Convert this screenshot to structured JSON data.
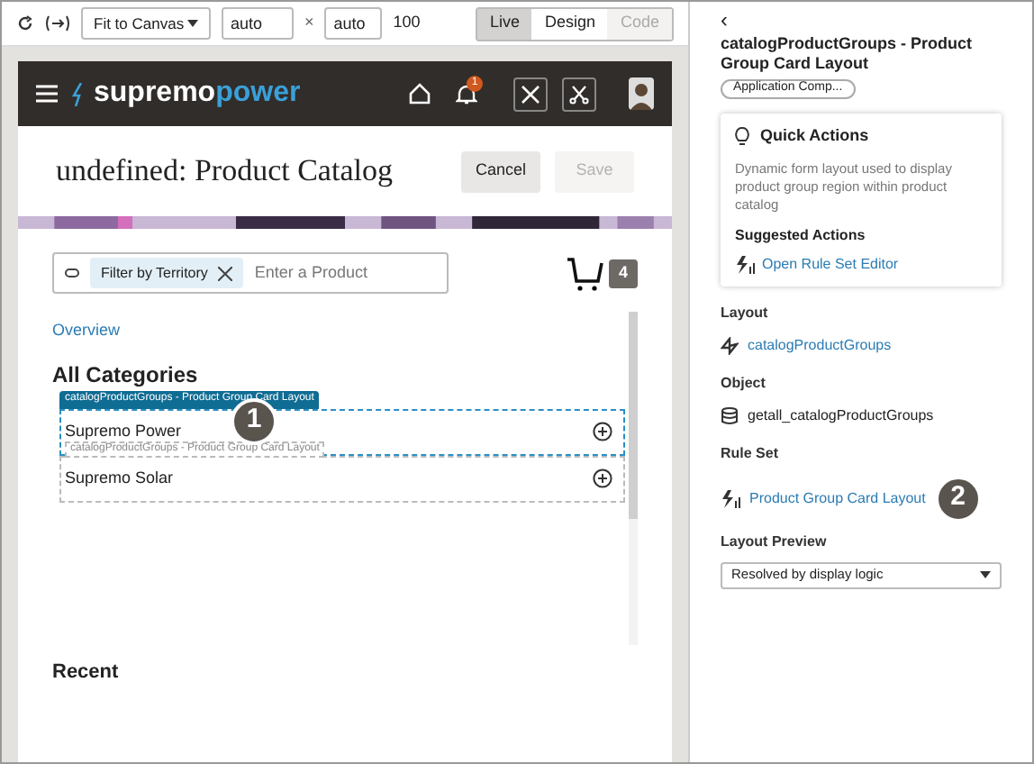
{
  "toolbar": {
    "fit_select": "Fit to Canvas",
    "width": "auto",
    "times": "×",
    "height": "auto",
    "zoom": "100",
    "modes": [
      {
        "label": "Live",
        "selected": true,
        "disabled": false
      },
      {
        "label": "Design",
        "selected": false,
        "disabled": false
      },
      {
        "label": "Code",
        "selected": false,
        "disabled": true
      }
    ]
  },
  "app": {
    "logo": [
      "supremo",
      "power"
    ],
    "notification_count": "1",
    "page_title": "undefined: Product Catalog",
    "buttons": [
      {
        "label": "Cancel",
        "disabled": false
      },
      {
        "label": "Save",
        "disabled": true
      }
    ],
    "search": {
      "chip": "Filter by Territory",
      "placeholder": "Enter a Product"
    },
    "cart_count": "4",
    "overview_link": "Overview",
    "section_title": "All Categories",
    "layout_tag": "catalogProductGroups - Product Group Card Layout",
    "callout_1": "1",
    "groups": [
      {
        "name": "Supremo Power",
        "hover_label": "catalogProductGroups - Product Group Card Layout",
        "selected": true
      },
      {
        "name": "Supremo Solar",
        "selected": false
      }
    ],
    "recent_title": "Recent"
  },
  "panel": {
    "back": "‹",
    "title": "catalogProductGroups - Product Group Card Layout",
    "chip": "Application Comp...",
    "quick_actions": {
      "title": "Quick Actions",
      "description": "Dynamic form layout used to display product group region within product catalog",
      "suggested_title": "Suggested Actions",
      "action": "Open Rule Set Editor"
    },
    "sections": [
      {
        "label": "Layout",
        "kind": "layout",
        "value": "catalogProductGroups"
      },
      {
        "label": "Object",
        "kind": "object",
        "value": "getall_catalogProductGroups"
      },
      {
        "label": "Rule Set",
        "kind": "ruleset",
        "value": "Product Group Card Layout",
        "callout": "2"
      }
    ],
    "preview_label": "Layout Preview",
    "preview_value": "Resolved by display logic"
  }
}
